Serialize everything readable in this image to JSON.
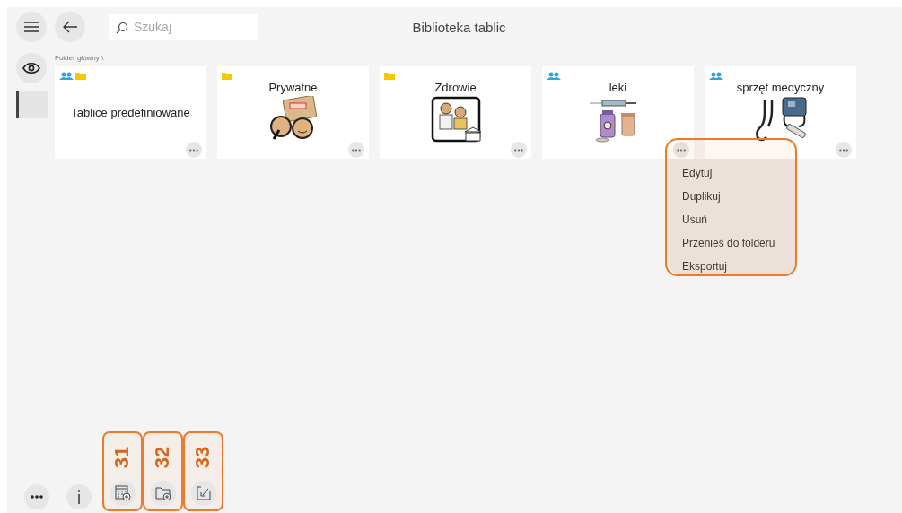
{
  "header": {
    "title": "Biblioteka tablic",
    "search": {
      "placeholder": "Szukaj"
    }
  },
  "breadcrumb": "Folder główny \\",
  "boards": [
    {
      "title": "Tablice predefiniowane",
      "shared": true,
      "folder": true,
      "menu_open": false
    },
    {
      "title": "Prywatne",
      "shared": false,
      "folder": true,
      "menu_open": false
    },
    {
      "title": "Zdrowie",
      "shared": false,
      "folder": true,
      "menu_open": false
    },
    {
      "title": "leki",
      "shared": true,
      "folder": false,
      "menu_open": true
    },
    {
      "title": "sprzęt medyczny",
      "shared": true,
      "folder": false,
      "menu_open": false
    }
  ],
  "menu": {
    "items": [
      "Edytuj",
      "Duplikuj",
      "Usuń",
      "Przenieś do folderu",
      "Eksportuj"
    ]
  },
  "bottom_buttons": [
    {
      "kind": "more"
    },
    {
      "kind": "info"
    },
    {
      "kind": "new-board",
      "callout": "31"
    },
    {
      "kind": "new-folder",
      "callout": "32"
    },
    {
      "kind": "import",
      "callout": "33"
    }
  ]
}
